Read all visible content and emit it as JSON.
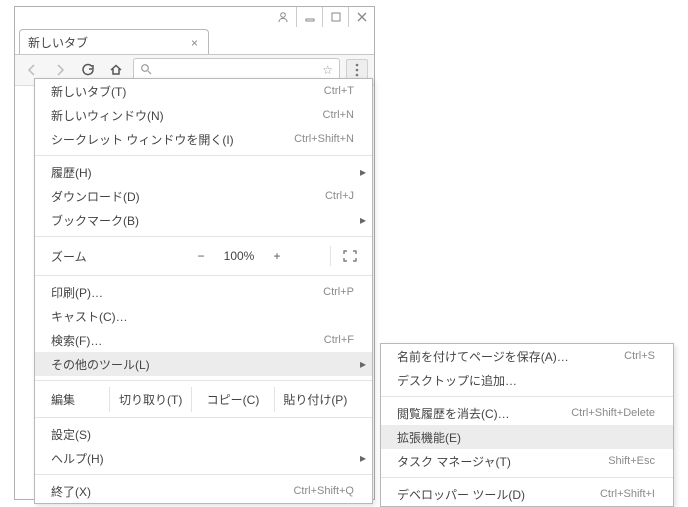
{
  "window": {
    "tab_title": "新しいタブ"
  },
  "address_bar": {
    "placeholder": ""
  },
  "menu": {
    "new_tab": "新しいタブ(T)",
    "new_tab_sc": "Ctrl+T",
    "new_window": "新しいウィンドウ(N)",
    "new_window_sc": "Ctrl+N",
    "incognito": "シークレット ウィンドウを開く(I)",
    "incognito_sc": "Ctrl+Shift+N",
    "history": "履歴(H)",
    "downloads": "ダウンロード(D)",
    "downloads_sc": "Ctrl+J",
    "bookmarks": "ブックマーク(B)",
    "zoom_label": "ズーム",
    "zoom_minus": "−",
    "zoom_value": "100%",
    "zoom_plus": "+",
    "print": "印刷(P)…",
    "print_sc": "Ctrl+P",
    "cast": "キャスト(C)…",
    "find": "検索(F)…",
    "find_sc": "Ctrl+F",
    "more_tools": "その他のツール(L)",
    "edit_label": "編集",
    "cut": "切り取り(T)",
    "copy": "コピー(C)",
    "paste": "貼り付け(P)",
    "settings": "設定(S)",
    "help": "ヘルプ(H)",
    "exit": "終了(X)",
    "exit_sc": "Ctrl+Shift+Q"
  },
  "submenu": {
    "save_as": "名前を付けてページを保存(A)…",
    "save_as_sc": "Ctrl+S",
    "add_desktop": "デスクトップに追加…",
    "clear_data": "閲覧履歴を消去(C)…",
    "clear_data_sc": "Ctrl+Shift+Delete",
    "extensions": "拡張機能(E)",
    "task_manager": "タスク マネージャ(T)",
    "task_manager_sc": "Shift+Esc",
    "dev_tools": "デベロッパー ツール(D)",
    "dev_tools_sc": "Ctrl+Shift+I"
  }
}
